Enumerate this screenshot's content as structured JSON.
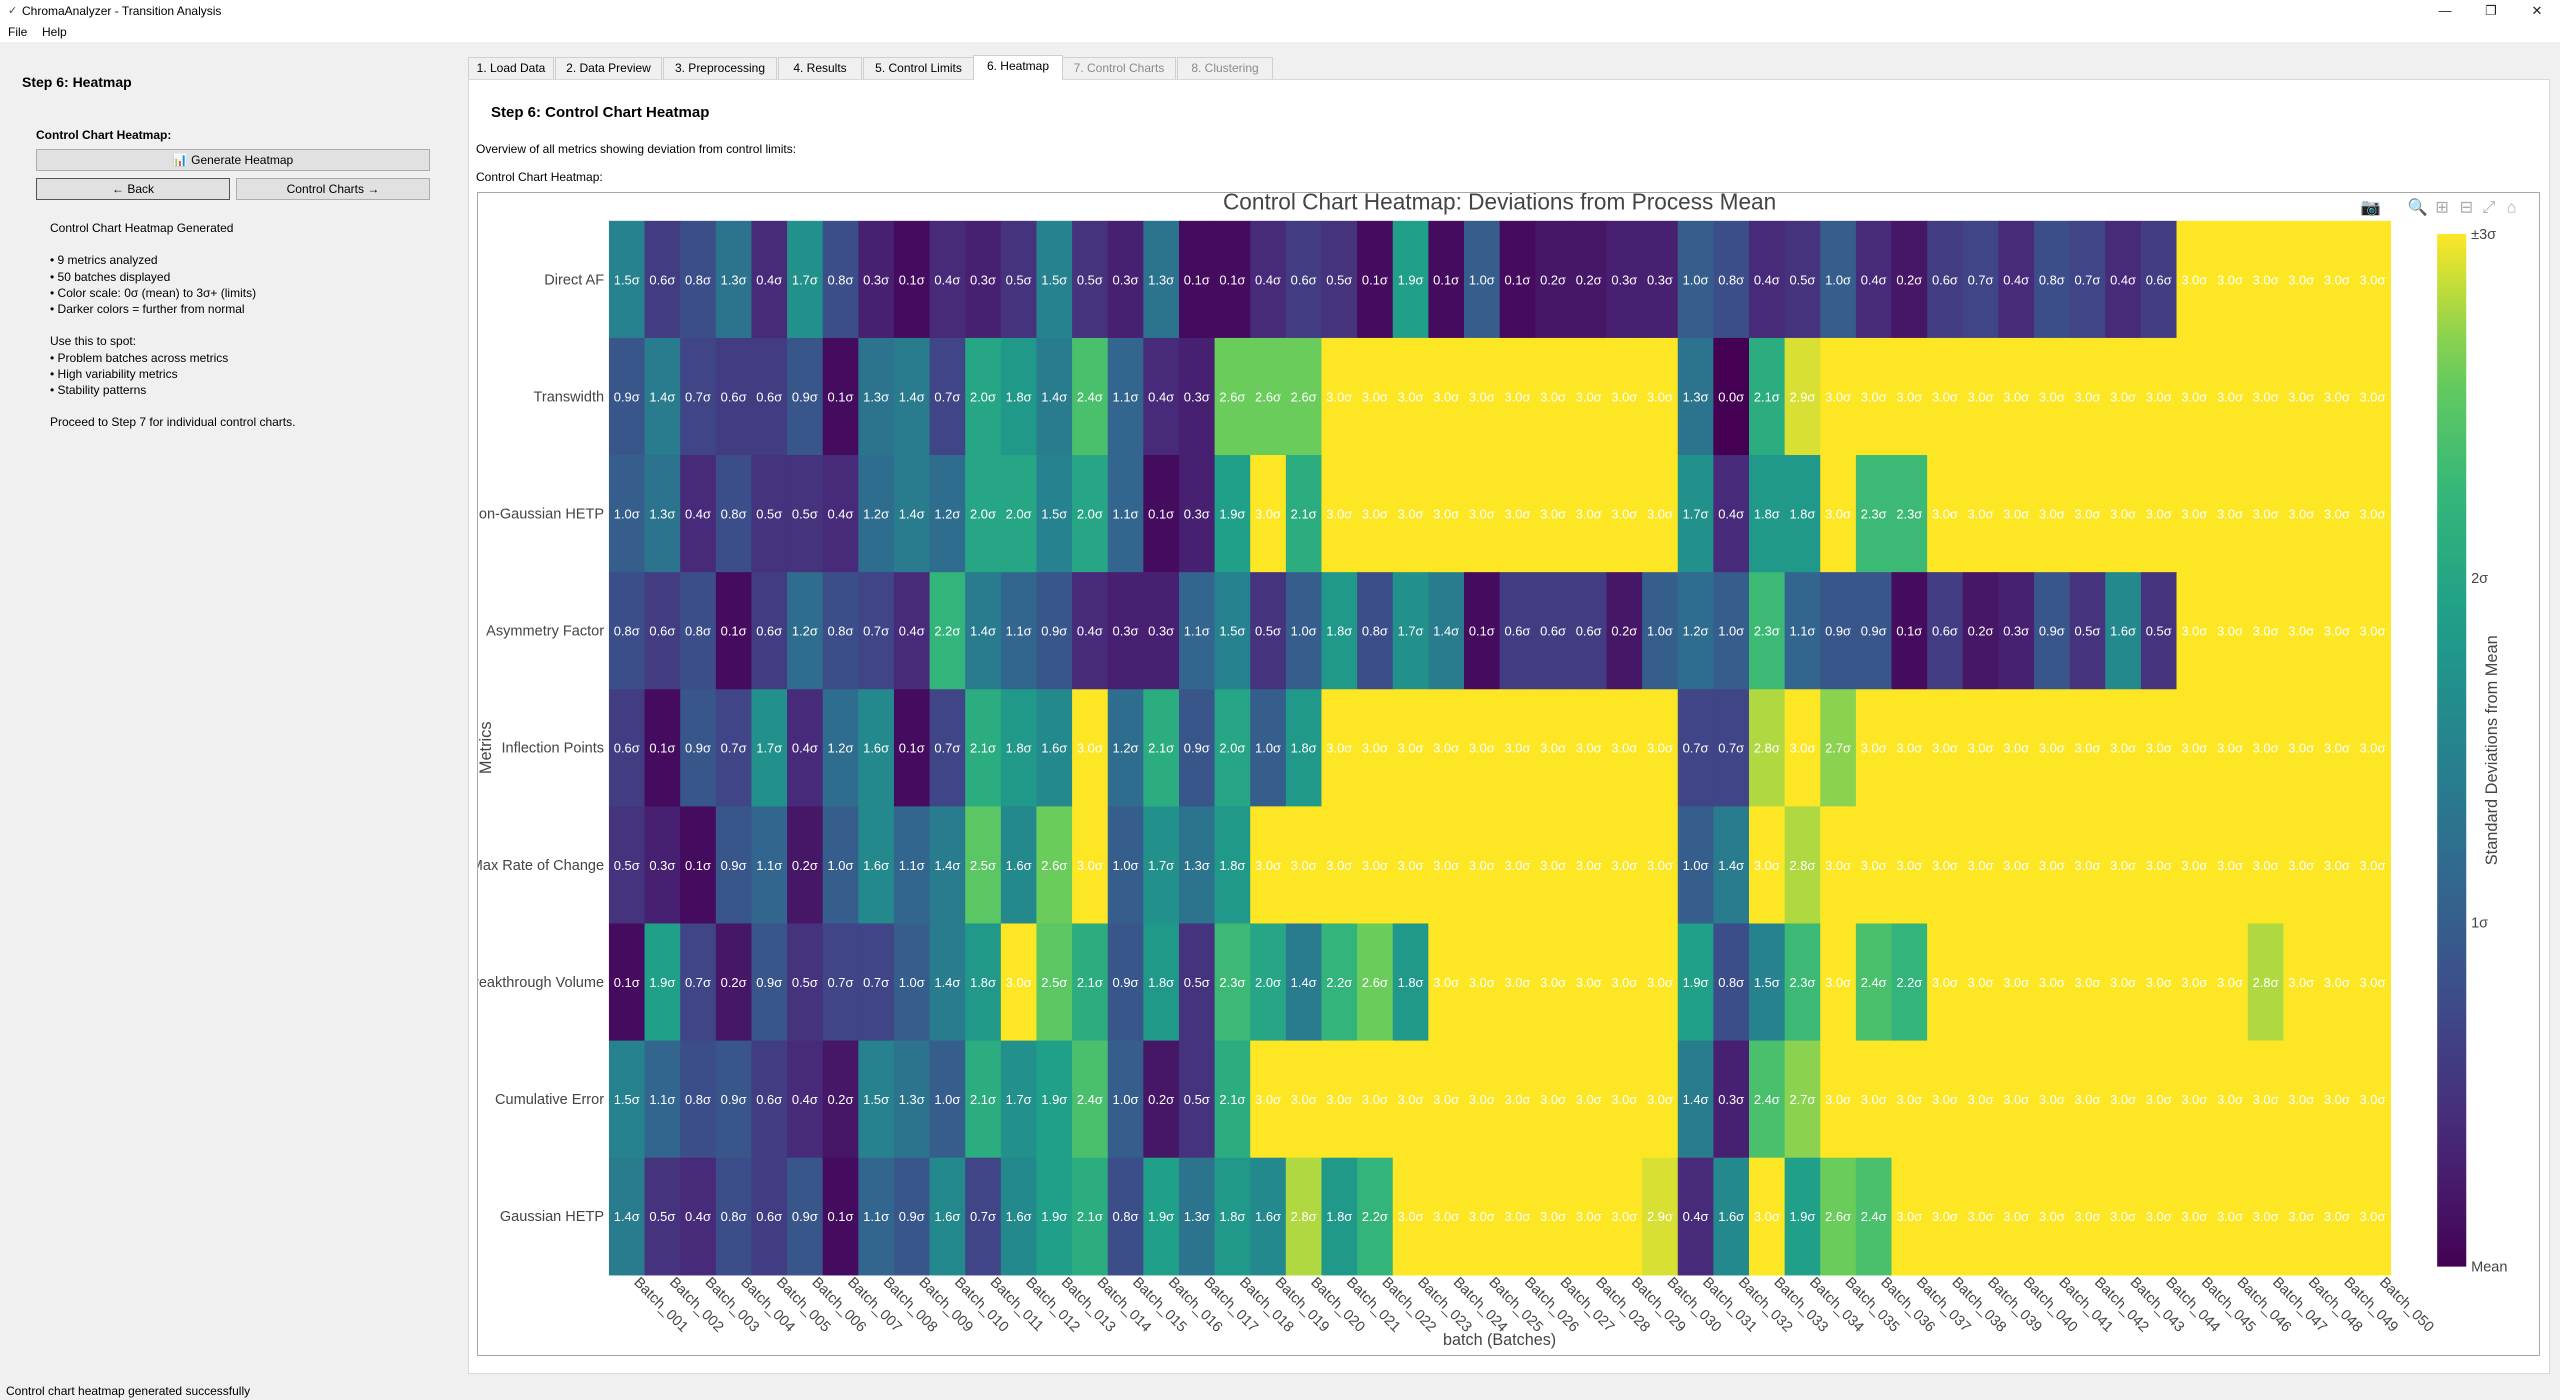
{
  "window": {
    "title": "ChromaAnalyzer - Transition Analysis",
    "minimize": "—",
    "maximize": "❐",
    "close": "✕"
  },
  "menu": [
    "File",
    "Help"
  ],
  "left_panel": {
    "heading": "Step 6: Heatmap",
    "section_label": "Control Chart Heatmap:",
    "generate_button": "📊 Generate Heatmap",
    "back_button": "← Back",
    "next_button": "Control Charts →",
    "info": "Control Chart Heatmap Generated\n\n• 9 metrics analyzed\n• 50 batches displayed\n• Color scale: 0σ (mean) to 3σ+ (limits)\n• Darker colors = further from normal\n\nUse this to spot:\n• Problem batches across metrics\n• High variability metrics\n• Stability patterns\n\nProceed to Step 7 for individual control charts."
  },
  "tabs": [
    {
      "label": "1. Load Data",
      "state": "normal"
    },
    {
      "label": "2. Data Preview",
      "state": "normal"
    },
    {
      "label": "3. Preprocessing",
      "state": "normal"
    },
    {
      "label": "4. Results",
      "state": "normal"
    },
    {
      "label": "5. Control Limits",
      "state": "normal"
    },
    {
      "label": "6. Heatmap",
      "state": "active"
    },
    {
      "label": "7. Control Charts",
      "state": "disabled"
    },
    {
      "label": "8. Clustering",
      "state": "disabled"
    }
  ],
  "content": {
    "title": "Step 6: Control Chart Heatmap",
    "overview": "Overview of all metrics showing deviation from control limits:",
    "heatmap_label": "Control Chart Heatmap:"
  },
  "toolbar_icons": [
    "camera-icon",
    "zoom-icon",
    "zoom-in-icon",
    "zoom-out-icon",
    "autoscale-icon",
    "home-icon"
  ],
  "chart_data": {
    "type": "heatmap",
    "title": "Control Chart Heatmap: Deviations from Process Mean",
    "xlabel": "batch (Batches)",
    "ylabel": "Metrics",
    "colorbar_title": "Standard Deviations from Mean",
    "colorbar_ticks": [
      {
        "value": 0,
        "label": "Mean"
      },
      {
        "value": 1,
        "label": "1σ"
      },
      {
        "value": 2,
        "label": "2σ"
      },
      {
        "value": 3,
        "label": "±3σ"
      }
    ],
    "zlim": [
      0,
      3
    ],
    "colorscale": "viridis",
    "x": [
      "Batch_001",
      "Batch_002",
      "Batch_003",
      "Batch_004",
      "Batch_005",
      "Batch_006",
      "Batch_007",
      "Batch_008",
      "Batch_009",
      "Batch_010",
      "Batch_011",
      "Batch_012",
      "Batch_013",
      "Batch_014",
      "Batch_015",
      "Batch_016",
      "Batch_017",
      "Batch_018",
      "Batch_019",
      "Batch_020",
      "Batch_021",
      "Batch_022",
      "Batch_023",
      "Batch_024",
      "Batch_025",
      "Batch_026",
      "Batch_027",
      "Batch_028",
      "Batch_029",
      "Batch_030",
      "Batch_031",
      "Batch_032",
      "Batch_033",
      "Batch_034",
      "Batch_035",
      "Batch_036",
      "Batch_037",
      "Batch_038",
      "Batch_039",
      "Batch_040",
      "Batch_041",
      "Batch_042",
      "Batch_043",
      "Batch_044",
      "Batch_045",
      "Batch_046",
      "Batch_047",
      "Batch_048",
      "Batch_049",
      "Batch_050"
    ],
    "y": [
      "Direct AF",
      "Transwidth",
      "Non-Gaussian HETP",
      "Asymmetry Factor",
      "Inflection Points",
      "Max Rate of Change",
      "Breakthrough Volume",
      "Cumulative Error",
      "Gaussian HETP"
    ],
    "z": [
      [
        1.5,
        0.6,
        0.8,
        1.3,
        0.4,
        1.7,
        0.8,
        0.3,
        0.1,
        0.4,
        0.3,
        0.5,
        1.5,
        0.5,
        0.3,
        1.3,
        0.1,
        0.1,
        0.4,
        0.6,
        0.5,
        0.1,
        1.9,
        0.1,
        1.0,
        0.1,
        0.2,
        0.2,
        0.3,
        0.3,
        1.0,
        0.8,
        0.4,
        0.5,
        1.0,
        0.4,
        0.2,
        0.6,
        0.7,
        0.4,
        0.8,
        0.7,
        0.4,
        0.6,
        3.0,
        3.0,
        3.0,
        3.0,
        3.0,
        3.0
      ],
      [
        0.9,
        1.4,
        0.7,
        0.6,
        0.6,
        0.9,
        0.1,
        1.3,
        1.4,
        0.7,
        2.0,
        1.8,
        1.4,
        2.4,
        1.1,
        0.4,
        0.3,
        2.6,
        2.6,
        2.6,
        3.0,
        3.0,
        3.0,
        3.0,
        3.0,
        3.0,
        3.0,
        3.0,
        3.0,
        3.0,
        1.3,
        0.0,
        2.1,
        2.9,
        3.0,
        3.0,
        3.0,
        3.0,
        3.0,
        3.0,
        3.0,
        3.0,
        3.0,
        3.0,
        3.0,
        3.0,
        3.0,
        3.0,
        3.0,
        3.0
      ],
      [
        1.0,
        1.3,
        0.4,
        0.8,
        0.5,
        0.5,
        0.4,
        1.2,
        1.4,
        1.2,
        2.0,
        2.0,
        1.5,
        2.0,
        1.1,
        0.1,
        0.3,
        1.9,
        3.0,
        2.1,
        3.0,
        3.0,
        3.0,
        3.0,
        3.0,
        3.0,
        3.0,
        3.0,
        3.0,
        3.0,
        1.7,
        0.4,
        1.8,
        1.8,
        3.0,
        2.3,
        2.3,
        3.0,
        3.0,
        3.0,
        3.0,
        3.0,
        3.0,
        3.0,
        3.0,
        3.0,
        3.0,
        3.0,
        3.0,
        3.0
      ],
      [
        0.8,
        0.6,
        0.8,
        0.1,
        0.6,
        1.2,
        0.8,
        0.7,
        0.4,
        2.2,
        1.4,
        1.1,
        0.9,
        0.4,
        0.3,
        0.3,
        1.1,
        1.5,
        0.5,
        1.0,
        1.8,
        0.8,
        1.7,
        1.4,
        0.1,
        0.6,
        0.6,
        0.6,
        0.2,
        1.0,
        1.2,
        1.0,
        2.3,
        1.1,
        0.9,
        0.9,
        0.1,
        0.6,
        0.2,
        0.3,
        0.9,
        0.5,
        1.6,
        0.5,
        3.0,
        3.0,
        3.0,
        3.0,
        3.0,
        3.0
      ],
      [
        0.6,
        0.1,
        0.9,
        0.7,
        1.7,
        0.4,
        1.2,
        1.6,
        0.1,
        0.7,
        2.1,
        1.8,
        1.6,
        3.0,
        1.2,
        2.1,
        0.9,
        2.0,
        1.0,
        1.8,
        3.0,
        3.0,
        3.0,
        3.0,
        3.0,
        3.0,
        3.0,
        3.0,
        3.0,
        3.0,
        0.7,
        0.7,
        2.8,
        3.0,
        2.7,
        3.0,
        3.0,
        3.0,
        3.0,
        3.0,
        3.0,
        3.0,
        3.0,
        3.0,
        3.0,
        3.0,
        3.0,
        3.0,
        3.0,
        3.0
      ],
      [
        0.5,
        0.3,
        0.1,
        0.9,
        1.1,
        0.2,
        1.0,
        1.6,
        1.1,
        1.4,
        2.5,
        1.6,
        2.6,
        3.0,
        1.0,
        1.7,
        1.3,
        1.8,
        3.0,
        3.0,
        3.0,
        3.0,
        3.0,
        3.0,
        3.0,
        3.0,
        3.0,
        3.0,
        3.0,
        3.0,
        1.0,
        1.4,
        3.0,
        2.8,
        3.0,
        3.0,
        3.0,
        3.0,
        3.0,
        3.0,
        3.0,
        3.0,
        3.0,
        3.0,
        3.0,
        3.0,
        3.0,
        3.0,
        3.0,
        3.0
      ],
      [
        0.1,
        1.9,
        0.7,
        0.2,
        0.9,
        0.5,
        0.7,
        0.7,
        1.0,
        1.4,
        1.8,
        3.0,
        2.5,
        2.1,
        0.9,
        1.8,
        0.5,
        2.3,
        2.0,
        1.4,
        2.2,
        2.6,
        1.8,
        3.0,
        3.0,
        3.0,
        3.0,
        3.0,
        3.0,
        3.0,
        1.9,
        0.8,
        1.5,
        2.3,
        3.0,
        2.4,
        2.2,
        3.0,
        3.0,
        3.0,
        3.0,
        3.0,
        3.0,
        3.0,
        3.0,
        3.0,
        2.8,
        3.0,
        3.0,
        3.0
      ],
      [
        1.5,
        1.1,
        0.8,
        0.9,
        0.6,
        0.4,
        0.2,
        1.5,
        1.3,
        1.0,
        2.1,
        1.7,
        1.9,
        2.4,
        1.0,
        0.2,
        0.5,
        2.1,
        3.0,
        3.0,
        3.0,
        3.0,
        3.0,
        3.0,
        3.0,
        3.0,
        3.0,
        3.0,
        3.0,
        3.0,
        1.4,
        0.3,
        2.4,
        2.7,
        3.0,
        3.0,
        3.0,
        3.0,
        3.0,
        3.0,
        3.0,
        3.0,
        3.0,
        3.0,
        3.0,
        3.0,
        3.0,
        3.0,
        3.0,
        3.0
      ],
      [
        1.4,
        0.5,
        0.4,
        0.8,
        0.6,
        0.9,
        0.1,
        1.1,
        0.9,
        1.6,
        0.7,
        1.6,
        1.9,
        2.1,
        0.8,
        1.9,
        1.3,
        1.8,
        1.6,
        2.8,
        1.8,
        2.2,
        3.0,
        3.0,
        3.0,
        3.0,
        3.0,
        3.0,
        3.0,
        2.9,
        0.4,
        1.6,
        3.0,
        1.9,
        2.6,
        2.4,
        3.0,
        3.0,
        3.0,
        3.0,
        3.0,
        3.0,
        3.0,
        3.0,
        3.0,
        3.0,
        3.0,
        3.0,
        3.0,
        3.0
      ]
    ]
  },
  "status": "Control chart heatmap generated successfully"
}
